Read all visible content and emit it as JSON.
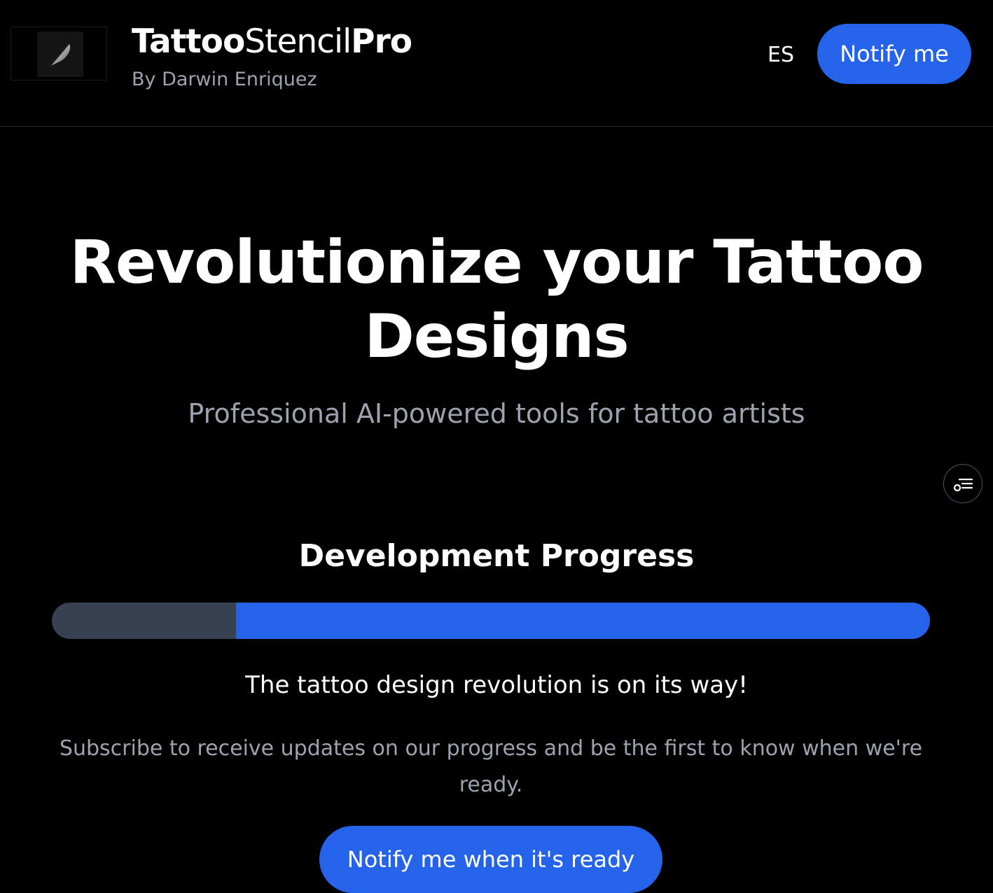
{
  "header": {
    "brand_part1": "Tattoo",
    "brand_part2": "Stencil",
    "brand_part3": "Pro",
    "byline": "By Darwin Enriquez",
    "language_toggle": "ES",
    "notify_label": "Notify me"
  },
  "hero": {
    "title": "Revolutionize your Tattoo Designs",
    "subtitle": "Professional AI-powered tools for tattoo artists"
  },
  "progress": {
    "title": "Development Progress",
    "percent": 79,
    "tagline": "The tattoo design revolution is on its way!",
    "subscribe_text": "Subscribe to receive updates on our progress and be the first to know when we're ready.",
    "cta_label": "Notify me when it's ready"
  },
  "colors": {
    "accent": "#2563eb",
    "track": "#374151",
    "muted_text": "#9ca3af",
    "background": "#000000"
  },
  "icons": {
    "logo": "feather-icon",
    "floating": "filter-list-icon"
  }
}
